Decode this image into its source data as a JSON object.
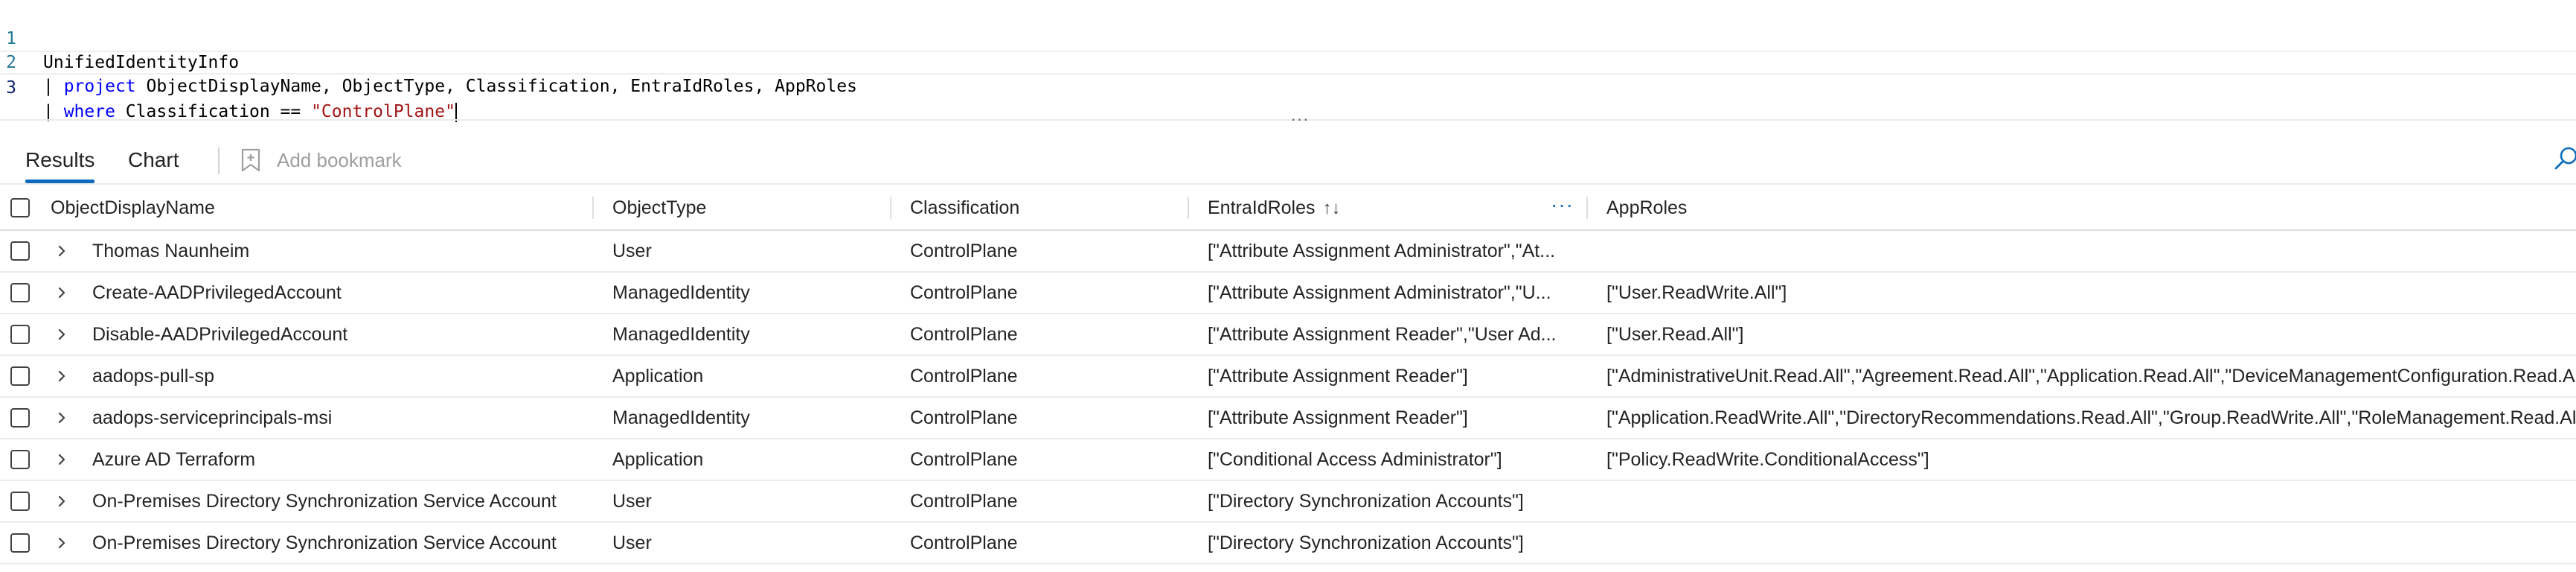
{
  "editor": {
    "lines": [
      {
        "num": "1",
        "table": "UnifiedIdentityInfo"
      },
      {
        "num": "2",
        "pipe": "| ",
        "keyword": "project",
        "rest": " ObjectDisplayName, ObjectType, Classification, EntraIdRoles, AppRoles"
      },
      {
        "num": "3",
        "pipe": "| ",
        "keyword": "where",
        "rest": " Classification == ",
        "string": "\"ControlPlane\""
      }
    ]
  },
  "tabs": [
    {
      "label": "Results",
      "selected": true
    },
    {
      "label": "Chart",
      "selected": false
    }
  ],
  "toolbar": {
    "bookmark_label": "Add bookmark",
    "bookmark_icon": "bookmark-add-icon",
    "search_icon": "search-icon"
  },
  "grid": {
    "columns": [
      {
        "label": "ObjectDisplayName"
      },
      {
        "label": "ObjectType"
      },
      {
        "label": "Classification"
      },
      {
        "label": "EntraIdRoles",
        "sort": "↑↓",
        "menu": "···"
      },
      {
        "label": "AppRoles"
      }
    ],
    "rows": [
      {
        "name": "Thomas Naunheim",
        "type": "User",
        "classification": "ControlPlane",
        "entra": "[\"Attribute Assignment Administrator\",\"At...",
        "app": ""
      },
      {
        "name": "Create-AADPrivilegedAccount",
        "type": "ManagedIdentity",
        "classification": "ControlPlane",
        "entra": "[\"Attribute Assignment Administrator\",\"U...",
        "app": "[\"User.ReadWrite.All\"]"
      },
      {
        "name": "Disable-AADPrivilegedAccount",
        "type": "ManagedIdentity",
        "classification": "ControlPlane",
        "entra": "[\"Attribute Assignment Reader\",\"User Ad...",
        "app": "[\"User.Read.All\"]"
      },
      {
        "name": "aadops-pull-sp",
        "type": "Application",
        "classification": "ControlPlane",
        "entra": "[\"Attribute Assignment Reader\"]",
        "app": "[\"AdministrativeUnit.Read.All\",\"Agreement.Read.All\",\"Application.Read.All\",\"DeviceManagementConfiguration.Read.All\"]"
      },
      {
        "name": "aadops-serviceprincipals-msi",
        "type": "ManagedIdentity",
        "classification": "ControlPlane",
        "entra": "[\"Attribute Assignment Reader\"]",
        "app": "[\"Application.ReadWrite.All\",\"DirectoryRecommendations.Read.All\",\"Group.ReadWrite.All\",\"RoleManagement.Read.All\"]"
      },
      {
        "name": "Azure AD Terraform",
        "type": "Application",
        "classification": "ControlPlane",
        "entra": "[\"Conditional Access Administrator\"]",
        "app": "[\"Policy.ReadWrite.ConditionalAccess\"]"
      },
      {
        "name": "On-Premises Directory Synchronization Service Account",
        "type": "User",
        "classification": "ControlPlane",
        "entra": "[\"Directory Synchronization Accounts\"]",
        "app": ""
      },
      {
        "name": "On-Premises Directory Synchronization Service Account",
        "type": "User",
        "classification": "ControlPlane",
        "entra": "[\"Directory Synchronization Accounts\"]",
        "app": ""
      }
    ]
  }
}
